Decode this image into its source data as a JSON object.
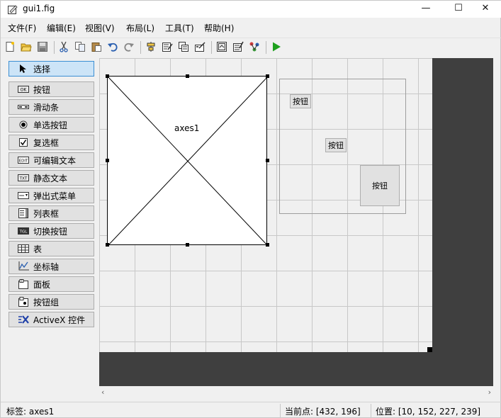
{
  "window": {
    "title": "gui1.fig",
    "min": "—",
    "max": "☐",
    "close": "✕"
  },
  "menu": [
    "文件(F)",
    "编辑(E)",
    "视图(V)",
    "布局(L)",
    "工具(T)",
    "帮助(H)"
  ],
  "toolbar": {
    "buttons": [
      "new-icon",
      "open-icon",
      "save-icon",
      "cut-icon",
      "copy-icon",
      "paste-icon",
      "undo-icon",
      "redo-icon",
      "align-icon",
      "menu-editor-icon",
      "tab-order-icon",
      "toolbar-editor-icon",
      "editor-icon",
      "property-inspector-icon",
      "object-browser-icon",
      "run-icon"
    ]
  },
  "palette": [
    {
      "label": "选择",
      "icon": "arrow-icon",
      "selected": true
    },
    {
      "label": "按钮",
      "icon": "pushbutton-icon"
    },
    {
      "label": "滑动条",
      "icon": "slider-icon"
    },
    {
      "label": "单选按钮",
      "icon": "radio-icon"
    },
    {
      "label": "复选框",
      "icon": "checkbox-icon"
    },
    {
      "label": "可编辑文本",
      "icon": "edit-text-icon"
    },
    {
      "label": "静态文本",
      "icon": "static-text-icon"
    },
    {
      "label": "弹出式菜单",
      "icon": "popup-menu-icon"
    },
    {
      "label": "列表框",
      "icon": "listbox-icon"
    },
    {
      "label": "切换按钮",
      "icon": "toggle-icon"
    },
    {
      "label": "表",
      "icon": "table-icon"
    },
    {
      "label": "坐标轴",
      "icon": "axes-icon"
    },
    {
      "label": "面板",
      "icon": "panel-icon"
    },
    {
      "label": "按钮组",
      "icon": "button-group-icon"
    },
    {
      "label": "ActiveX 控件",
      "icon": "activex-icon"
    }
  ],
  "canvas": {
    "axes_label": "axes1",
    "buttons": [
      "按钮",
      "按钮",
      "按钮"
    ]
  },
  "scroll": {
    "left": "‹",
    "right": "›"
  },
  "status": {
    "tag": "标签: axes1",
    "current_point": "当前点:  [432, 196]",
    "position": "位置: [10, 152, 227, 239]"
  }
}
